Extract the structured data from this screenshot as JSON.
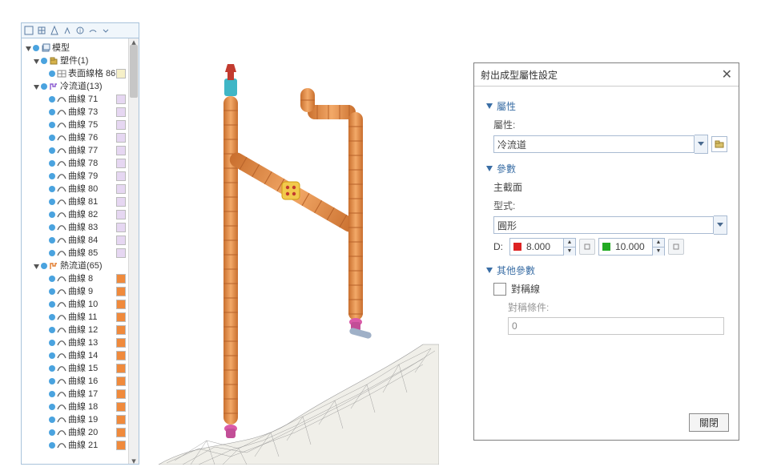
{
  "tree": {
    "root": "模型",
    "group_parts": {
      "label": "塑件(1)",
      "items": [
        {
          "label": "表面線格 86",
          "swatch": "#f6f0c8"
        }
      ]
    },
    "group_cold": {
      "label": "冷流道(13)",
      "items": [
        {
          "label": "曲線 71",
          "swatch": "#e6d7f2"
        },
        {
          "label": "曲線 73",
          "swatch": "#e6d7f2"
        },
        {
          "label": "曲線 75",
          "swatch": "#e6d7f2"
        },
        {
          "label": "曲線 76",
          "swatch": "#e6d7f2"
        },
        {
          "label": "曲線 77",
          "swatch": "#e6d7f2"
        },
        {
          "label": "曲線 78",
          "swatch": "#e6d7f2"
        },
        {
          "label": "曲線 79",
          "swatch": "#e6d7f2"
        },
        {
          "label": "曲線 80",
          "swatch": "#e6d7f2"
        },
        {
          "label": "曲線 81",
          "swatch": "#e6d7f2"
        },
        {
          "label": "曲線 82",
          "swatch": "#e6d7f2"
        },
        {
          "label": "曲線 83",
          "swatch": "#e6d7f2"
        },
        {
          "label": "曲線 84",
          "swatch": "#e6d7f2"
        },
        {
          "label": "曲線 85",
          "swatch": "#e6d7f2"
        }
      ]
    },
    "group_hot": {
      "label": "熱流道(65)",
      "items": [
        {
          "label": "曲線 8",
          "swatch": "#f08a3c"
        },
        {
          "label": "曲線 9",
          "swatch": "#f08a3c"
        },
        {
          "label": "曲線 10",
          "swatch": "#f08a3c"
        },
        {
          "label": "曲線 11",
          "swatch": "#f08a3c"
        },
        {
          "label": "曲線 12",
          "swatch": "#f08a3c"
        },
        {
          "label": "曲線 13",
          "swatch": "#f08a3c"
        },
        {
          "label": "曲線 14",
          "swatch": "#f08a3c"
        },
        {
          "label": "曲線 15",
          "swatch": "#f08a3c"
        },
        {
          "label": "曲線 16",
          "swatch": "#f08a3c"
        },
        {
          "label": "曲線 17",
          "swatch": "#f08a3c"
        },
        {
          "label": "曲線 18",
          "swatch": "#f08a3c"
        },
        {
          "label": "曲線 19",
          "swatch": "#f08a3c"
        },
        {
          "label": "曲線 20",
          "swatch": "#f08a3c"
        },
        {
          "label": "曲線 21",
          "swatch": "#f08a3c"
        }
      ]
    }
  },
  "dialog": {
    "title": "射出成型屬性設定",
    "sect_attr": "屬性",
    "attr_label": "屬性:",
    "attr_value": "冷流道",
    "sect_param": "參數",
    "param_sub": "主截面",
    "type_label": "型式:",
    "type_value": "圓形",
    "d_label": "D:",
    "d1": "8.000",
    "d2": "10.000",
    "sect_other": "其他參數",
    "sym_label": "對稱線",
    "sym_cond_label": "對稱條件:",
    "sym_cond_value": "0",
    "close_btn": "關閉"
  }
}
